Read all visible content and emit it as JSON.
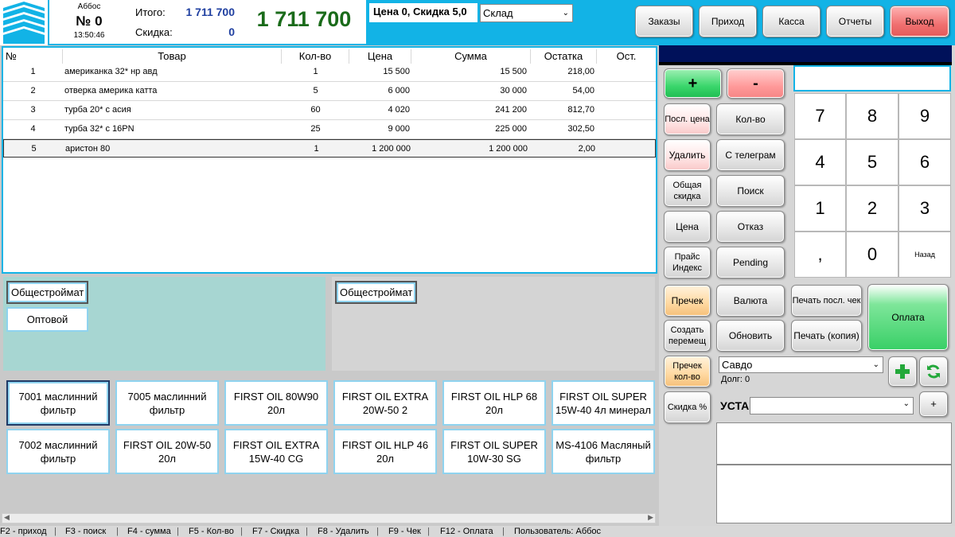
{
  "header": {
    "cashier": "Аббос",
    "order_no": "№ 0",
    "time": "13:50:46",
    "total_label": "Итого:",
    "total_value": "1 711 700",
    "discount_label": "Скидка:",
    "discount_value": "0",
    "big_total": "1 711 700",
    "price_info": "Цена 0,  Скидка 5,0",
    "warehouse": "Склад"
  },
  "nav": {
    "orders": "Заказы",
    "income": "Приход",
    "cash": "Касса",
    "reports": "Отчеты",
    "exit": "Выход"
  },
  "grid": {
    "columns": [
      "№",
      "Товар",
      "Кол-во",
      "Цена",
      "Сумма",
      "Остатка",
      "Ост."
    ],
    "rows": [
      {
        "n": "1",
        "item": "американка 32* нр авд",
        "qty": "1",
        "price": "15 500",
        "sum": "15 500",
        "stock": "218,00"
      },
      {
        "n": "2",
        "item": "отверка америка катта",
        "qty": "5",
        "price": "6 000",
        "sum": "30 000",
        "stock": "54,00"
      },
      {
        "n": "3",
        "item": "турба 20* с асия",
        "qty": "60",
        "price": "4 020",
        "sum": "241 200",
        "stock": "812,70"
      },
      {
        "n": "4",
        "item": "турба 32* с 16PN",
        "qty": "25",
        "price": "9 000",
        "sum": "225 000",
        "stock": "302,50"
      },
      {
        "n": "5",
        "item": "аристон 80",
        "qty": "1",
        "price": "1 200 000",
        "sum": "1 200 000",
        "stock": "2,00"
      }
    ]
  },
  "categories": {
    "left_primary": "Общестроймат",
    "left_secondary": "Оптовой",
    "right_primary": "Общестроймат"
  },
  "products": [
    "7001 маслинний фильтр",
    "7005 маслинний фильтр",
    "FIRST OIL 80W90 20л",
    "FIRST OIL EXTRA 20W-50 2",
    "FIRST OIL HLP 68 20л",
    "FIRST OIL SUPER 15W-40 4л минерал",
    "7002 маслинний фильтр",
    "FIRST OIL 20W-50 20л",
    "FIRST OIL EXTRA 15W-40 CG",
    "FIRST OIL HLP 46 20л",
    "FIRST OIL SUPER 10W-30 SG",
    "MS-4106 Масляный фильтр"
  ],
  "actions": {
    "plus": "+",
    "minus": "-",
    "last_price": "Посл. цена",
    "qty": "Кол-во",
    "delete": "Удалить",
    "from_telegram": "С телеграм",
    "total_discount": "Общая скидка",
    "search": "Поиск",
    "price": "Цена",
    "refuse": "Отказ",
    "price_index": "Прайс Индекс",
    "pending": "Pending"
  },
  "keypad": [
    "7",
    "8",
    "9",
    "4",
    "5",
    "6",
    "1",
    "2",
    "3",
    ",",
    "0",
    "Назад"
  ],
  "bottom": {
    "prechek": "Пречек",
    "currency": "Валюта",
    "print_last": "Печать посл. чек",
    "pay": "Оплата",
    "create_move": "Создать перемещ",
    "refresh": "Обновить",
    "print_copy": "Печать (копия)",
    "prechek_qty": "Пречек кол-во",
    "discount_pct": "Скидка %",
    "customer": "Савдо",
    "debt": "Долг: 0",
    "master_label": "УСТА",
    "master_add": "+"
  },
  "status": [
    "F2 - приход",
    "F3 - поиск",
    "F4 - сумма",
    "F5 - Кол-во",
    "F7 - Скидка",
    "F8 - Удалить",
    "F9 - Чек",
    "F12 - Оплата",
    "Пользователь: Аббос"
  ],
  "colors": {
    "accent": "#12b3e6",
    "total_green": "#1a6b1a",
    "total_blue": "#1f3fa0",
    "teal_panel": "#a7d6d2"
  }
}
